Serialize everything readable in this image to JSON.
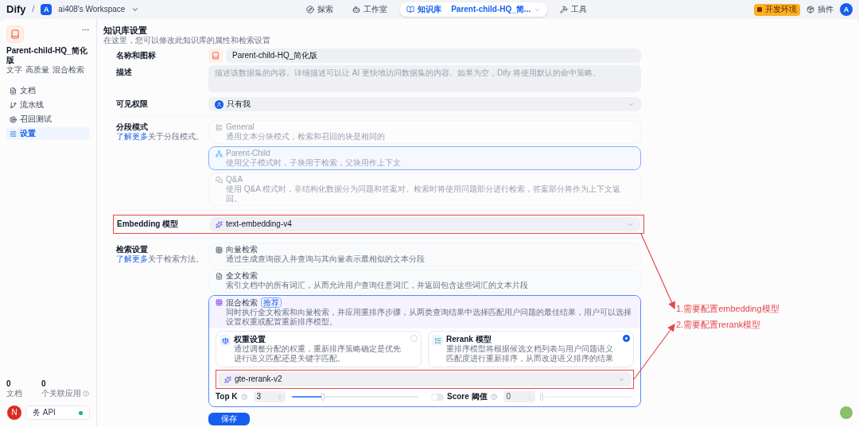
{
  "topbar": {
    "logo": "Dify",
    "separator": "/",
    "workspace": {
      "initial": "A",
      "name": "ai408's Workspace"
    },
    "nav": [
      {
        "label": "探索",
        "selected": false
      },
      {
        "label": "工作室",
        "selected": false
      },
      {
        "label": "知识库",
        "selected": true
      },
      {
        "label": "工具",
        "selected": false
      }
    ],
    "dataset_picker": "Parent-child-HQ_简...",
    "env_badge": "开发环境",
    "plugins": "插件",
    "avatar": "A"
  },
  "sidebar": {
    "title": "Parent-child-HQ_简化版",
    "tags": [
      "文字",
      "高质量",
      "混合检索"
    ],
    "items": [
      {
        "label": "文档",
        "selected": false
      },
      {
        "label": "流水线",
        "selected": false
      },
      {
        "label": "召回测试",
        "selected": false
      },
      {
        "label": "设置",
        "selected": true
      }
    ],
    "stats": [
      {
        "value": "0",
        "label": "文档"
      },
      {
        "value": "0",
        "label": "个关联应用"
      }
    ],
    "api": {
      "label": "务 API",
      "online": true
    },
    "floating_avatar": "N"
  },
  "settings": {
    "title": "知识库设置",
    "subtitle": "在这里，您可以修改此知识库的属性和检索设置",
    "name": {
      "label": "名称和图标",
      "value": "Parent-child-HQ_简化版"
    },
    "description": {
      "label": "描述",
      "placeholder": "描述该数据集的内容。详细描述可以让 AI 更快地访问数据集的内容。如果为空，Dify 将使用默认的命中策略。"
    },
    "visibility": {
      "label": "可见权限",
      "value": "只有我"
    },
    "chunk_mode": {
      "label": "分段模式",
      "link": "了解更多",
      "link_suffix": "关于分段模式。",
      "options": [
        {
          "title": "General",
          "desc": "通用文本分块模式，检索和召回的块是相同的",
          "selected": false
        },
        {
          "title": "Parent-Child",
          "desc": "使用父子模式时，子块用于检索，父块用作上下文",
          "selected": true
        },
        {
          "title": "Q&A",
          "desc": "使用 Q&A 模式时，非结构化数据分为问题和答案对。检索时将使用问题部分进行检索，答案部分将作为上下文返回。",
          "selected": false
        }
      ]
    },
    "embedding": {
      "label": "Embedding 模型",
      "value": "text-embedding-v4",
      "highlighted": true
    },
    "retrieval": {
      "label": "检索设置",
      "link": "了解更多",
      "link_suffix": "关于检索方法。",
      "options": [
        {
          "title": "向量检索",
          "desc": "通过生成查询嵌入并查询与其向量表示最相似的文本分段",
          "selected": false
        },
        {
          "title": "全文检索",
          "desc": "索引文档中的所有词汇，从而允许用户查询任意词汇，并返回包含这些词汇的文本片段",
          "selected": false
        },
        {
          "title": "混合检索",
          "badge": "推荐",
          "desc": "同时执行全文检索和向量检索，并应用重排序步骤，从两类查询结果中选择匹配用户问题的最佳结果，用户可以选择设置权重或配置重新排序模型。",
          "selected": true
        }
      ],
      "sub_options": [
        {
          "title": "权重设置",
          "desc": "通过调整分配的权重，重新排序策略确定是优先进行语义匹配还是关键字匹配。",
          "selected": false
        },
        {
          "title": "Rerank 模型",
          "desc": "重排序模型将根据候选文档列表与用户问题语义匹配度进行重新排序，从而改进语义排序的结果",
          "selected": true
        }
      ],
      "rerank_model": {
        "value": "gte-rerank-v2",
        "highlighted": true
      },
      "top_k": {
        "label": "Top K",
        "value": "3",
        "level": 0.25
      },
      "score": {
        "label": "Score 阈值",
        "on": false,
        "value": "0",
        "level": 0
      }
    },
    "save": "保存"
  },
  "annotations": [
    "1.需要配置embedding模型",
    "2.需要配置rerank模型"
  ]
}
